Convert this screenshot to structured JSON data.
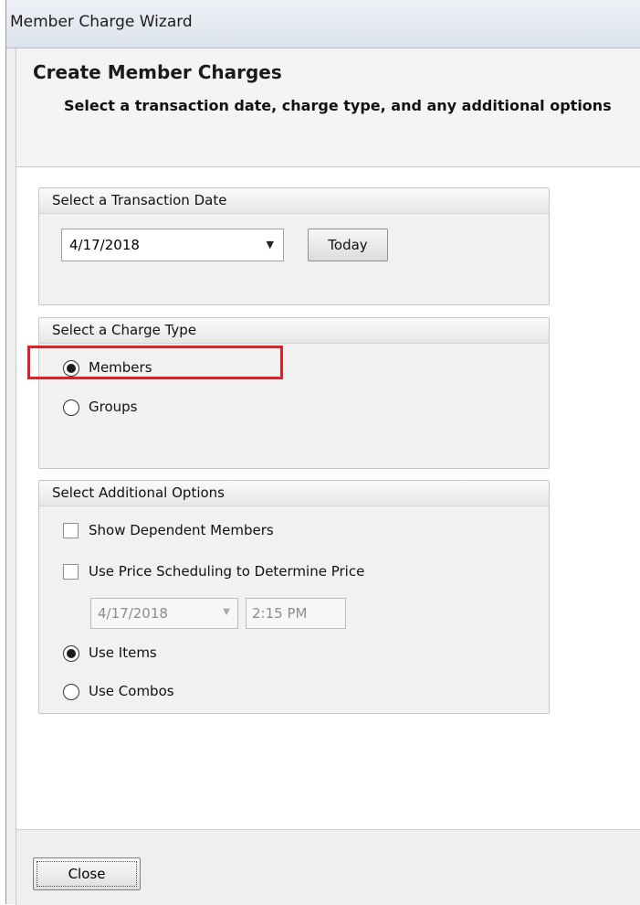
{
  "window": {
    "title": "Member Charge Wizard"
  },
  "header": {
    "title": "Create Member Charges",
    "subtitle": "Select a transaction date, charge type, and any additional options"
  },
  "transaction_date": {
    "heading": "Select a Transaction Date",
    "date_value": "4/17/2018",
    "today_button": "Today"
  },
  "charge_type": {
    "heading": "Select a Charge Type",
    "options": [
      {
        "label": "Members",
        "selected": true
      },
      {
        "label": "Groups",
        "selected": false
      }
    ]
  },
  "additional_options": {
    "heading": "Select Additional Options",
    "show_dependent_members": {
      "label": "Show Dependent Members",
      "checked": false
    },
    "use_price_scheduling": {
      "label": "Use Price Scheduling to Determine Price",
      "checked": false
    },
    "schedule_date": "4/17/2018",
    "schedule_time": "2:15 PM",
    "item_options": [
      {
        "label": "Use Items",
        "selected": true
      },
      {
        "label": "Use Combos",
        "selected": false
      }
    ]
  },
  "footer": {
    "close_button": "Close"
  },
  "colors": {
    "highlight": "#e01f26"
  },
  "icons": {
    "dropdown": "chevron-down-icon"
  }
}
